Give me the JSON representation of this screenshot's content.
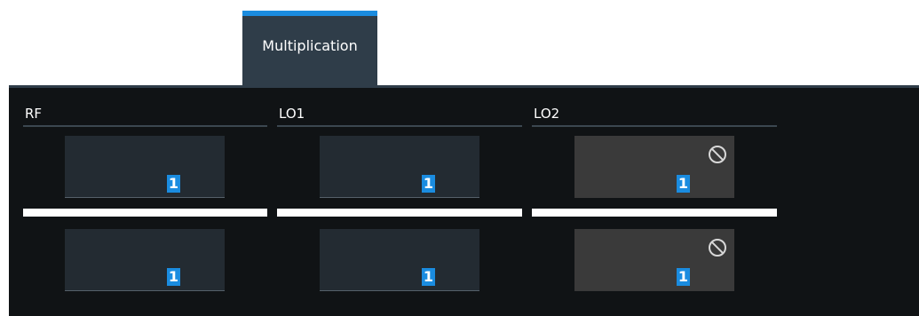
{
  "tab": {
    "label": "Multiplication",
    "accent_color": "#1a8ce0"
  },
  "columns": [
    {
      "header": "RF",
      "numerator": "1",
      "denominator": "1",
      "disabled": false
    },
    {
      "header": "LO1",
      "numerator": "1",
      "denominator": "1",
      "disabled": false
    },
    {
      "header": "LO2",
      "numerator": "1",
      "denominator": "1",
      "disabled": true
    }
  ],
  "icons": {
    "disabled_indicator": "no-entry-icon"
  }
}
